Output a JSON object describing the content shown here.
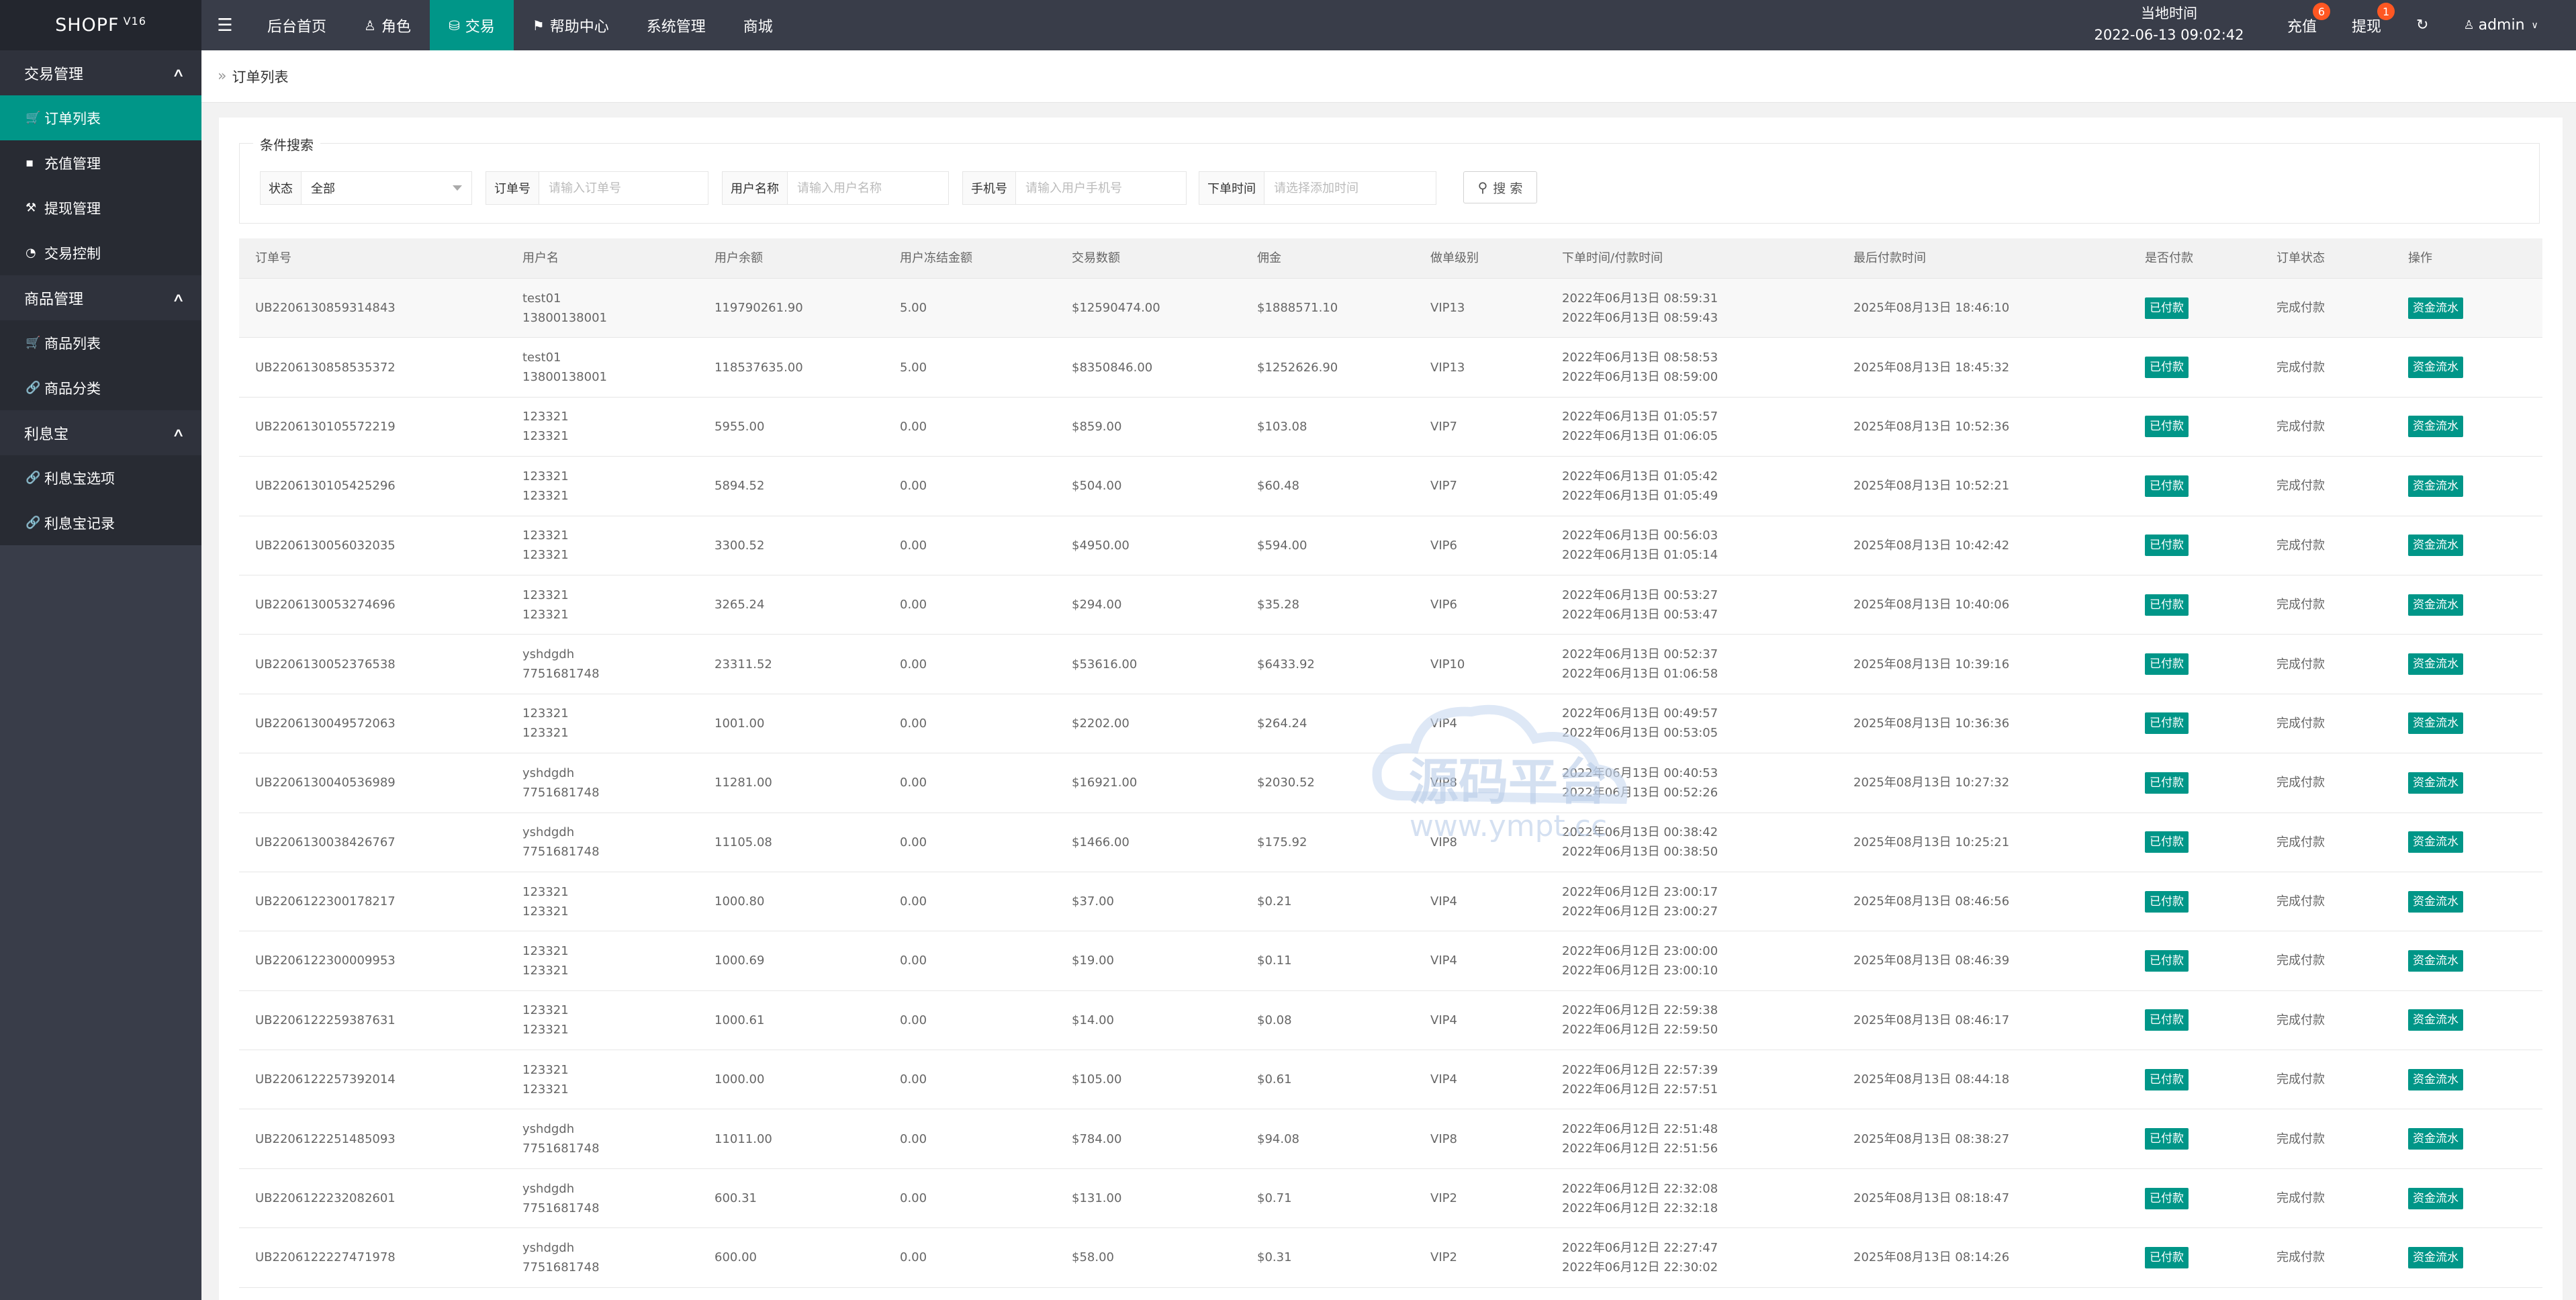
{
  "app": {
    "logo": "SHOPF",
    "version": "V16",
    "time_label": "当地时间",
    "time_value": "2022-06-13 09:02:42"
  },
  "topnav": {
    "items": [
      {
        "label": "后台首页"
      },
      {
        "label": "角色"
      },
      {
        "label": "交易"
      },
      {
        "label": "帮助中心"
      },
      {
        "label": "系统管理"
      },
      {
        "label": "商城"
      }
    ],
    "recharge_label": "充值",
    "recharge_badge": "6",
    "withdraw_label": "提现",
    "withdraw_badge": "1",
    "user_label": "admin"
  },
  "sidebar": {
    "group1": "交易管理",
    "g1_items": [
      "订单列表",
      "充值管理",
      "提现管理",
      "交易控制"
    ],
    "group2": "商品管理",
    "g2_items": [
      "商品列表",
      "商品分类"
    ],
    "group3": "利息宝",
    "g3_items": [
      "利息宝选项",
      "利息宝记录"
    ]
  },
  "breadcrumb": "订单列表",
  "search": {
    "legend": "条件搜索",
    "status_label": "状态",
    "status_value": "全部",
    "order_label": "订单号",
    "order_placeholder": "请输入订单号",
    "username_label": "用户名称",
    "username_placeholder": "请输入用户名称",
    "phone_label": "手机号",
    "phone_placeholder": "请输入用户手机号",
    "time_label": "下单时间",
    "time_placeholder": "请选择添加时间",
    "button": "搜 索"
  },
  "table": {
    "headers": [
      "订单号",
      "用户名",
      "用户余额",
      "用户冻结金额",
      "交易数额",
      "佣金",
      "做单级别",
      "下单时间/付款时间",
      "最后付款时间",
      "是否付款",
      "订单状态",
      "操作"
    ],
    "rows": [
      [
        "UB2206130859314843",
        "test01",
        "13800138001",
        "119790261.90",
        "5.00",
        "$12590474.00",
        "$1888571.10",
        "VIP13",
        "2022年06月13日 08:59:31",
        "2022年06月13日 08:59:43",
        "2025年08月13日 18:46:10",
        "已付款",
        "完成付款",
        "资金流水"
      ],
      [
        "UB2206130858535372",
        "test01",
        "13800138001",
        "118537635.00",
        "5.00",
        "$8350846.00",
        "$1252626.90",
        "VIP13",
        "2022年06月13日 08:58:53",
        "2022年06月13日 08:59:00",
        "2025年08月13日 18:45:32",
        "已付款",
        "完成付款",
        "资金流水"
      ],
      [
        "UB2206130105572219",
        "123321",
        "123321",
        "5955.00",
        "0.00",
        "$859.00",
        "$103.08",
        "VIP7",
        "2022年06月13日 01:05:57",
        "2022年06月13日 01:06:05",
        "2025年08月13日 10:52:36",
        "已付款",
        "完成付款",
        "资金流水"
      ],
      [
        "UB2206130105425296",
        "123321",
        "123321",
        "5894.52",
        "0.00",
        "$504.00",
        "$60.48",
        "VIP7",
        "2022年06月13日 01:05:42",
        "2022年06月13日 01:05:49",
        "2025年08月13日 10:52:21",
        "已付款",
        "完成付款",
        "资金流水"
      ],
      [
        "UB2206130056032035",
        "123321",
        "123321",
        "3300.52",
        "0.00",
        "$4950.00",
        "$594.00",
        "VIP6",
        "2022年06月13日 00:56:03",
        "2022年06月13日 01:05:14",
        "2025年08月13日 10:42:42",
        "已付款",
        "完成付款",
        "资金流水"
      ],
      [
        "UB2206130053274696",
        "123321",
        "123321",
        "3265.24",
        "0.00",
        "$294.00",
        "$35.28",
        "VIP6",
        "2022年06月13日 00:53:27",
        "2022年06月13日 00:53:47",
        "2025年08月13日 10:40:06",
        "已付款",
        "完成付款",
        "资金流水"
      ],
      [
        "UB2206130052376538",
        "yshdgdh",
        "7751681748",
        "23311.52",
        "0.00",
        "$53616.00",
        "$6433.92",
        "VIP10",
        "2022年06月13日 00:52:37",
        "2022年06月13日 01:06:58",
        "2025年08月13日 10:39:16",
        "已付款",
        "完成付款",
        "资金流水"
      ],
      [
        "UB2206130049572063",
        "123321",
        "123321",
        "1001.00",
        "0.00",
        "$2202.00",
        "$264.24",
        "VIP4",
        "2022年06月13日 00:49:57",
        "2022年06月13日 00:53:05",
        "2025年08月13日 10:36:36",
        "已付款",
        "完成付款",
        "资金流水"
      ],
      [
        "UB2206130040536989",
        "yshdgdh",
        "7751681748",
        "11281.00",
        "0.00",
        "$16921.00",
        "$2030.52",
        "VIP8",
        "2022年06月13日 00:40:53",
        "2022年06月13日 00:52:26",
        "2025年08月13日 10:27:32",
        "已付款",
        "完成付款",
        "资金流水"
      ],
      [
        "UB2206130038426767",
        "yshdgdh",
        "7751681748",
        "11105.08",
        "0.00",
        "$1466.00",
        "$175.92",
        "VIP8",
        "2022年06月13日 00:38:42",
        "2022年06月13日 00:38:50",
        "2025年08月13日 10:25:21",
        "已付款",
        "完成付款",
        "资金流水"
      ],
      [
        "UB2206122300178217",
        "123321",
        "123321",
        "1000.80",
        "0.00",
        "$37.00",
        "$0.21",
        "VIP4",
        "2022年06月12日 23:00:17",
        "2022年06月12日 23:00:27",
        "2025年08月13日 08:46:56",
        "已付款",
        "完成付款",
        "资金流水"
      ],
      [
        "UB2206122300009953",
        "123321",
        "123321",
        "1000.69",
        "0.00",
        "$19.00",
        "$0.11",
        "VIP4",
        "2022年06月12日 23:00:00",
        "2022年06月12日 23:00:10",
        "2025年08月13日 08:46:39",
        "已付款",
        "完成付款",
        "资金流水"
      ],
      [
        "UB2206122259387631",
        "123321",
        "123321",
        "1000.61",
        "0.00",
        "$14.00",
        "$0.08",
        "VIP4",
        "2022年06月12日 22:59:38",
        "2022年06月12日 22:59:50",
        "2025年08月13日 08:46:17",
        "已付款",
        "完成付款",
        "资金流水"
      ],
      [
        "UB2206122257392014",
        "123321",
        "123321",
        "1000.00",
        "0.00",
        "$105.00",
        "$0.61",
        "VIP4",
        "2022年06月12日 22:57:39",
        "2022年06月12日 22:57:51",
        "2025年08月13日 08:44:18",
        "已付款",
        "完成付款",
        "资金流水"
      ],
      [
        "UB2206122251485093",
        "yshdgdh",
        "7751681748",
        "11011.00",
        "0.00",
        "$784.00",
        "$94.08",
        "VIP8",
        "2022年06月12日 22:51:48",
        "2022年06月12日 22:51:56",
        "2025年08月13日 08:38:27",
        "已付款",
        "完成付款",
        "资金流水"
      ],
      [
        "UB2206122232082601",
        "yshdgdh",
        "7751681748",
        "600.31",
        "0.00",
        "$131.00",
        "$0.71",
        "VIP2",
        "2022年06月12日 22:32:08",
        "2022年06月12日 22:32:18",
        "2025年08月13日 08:18:47",
        "已付款",
        "完成付款",
        "资金流水"
      ],
      [
        "UB2206122227471978",
        "yshdgdh",
        "7751681748",
        "600.00",
        "0.00",
        "$58.00",
        "$0.31",
        "VIP2",
        "2022年06月12日 22:27:47",
        "2022年06月12日 22:30:02",
        "2025年08月13日 08:14:26",
        "已付款",
        "完成付款",
        "资金流水"
      ]
    ]
  },
  "watermark": {
    "title": "源码平台",
    "url": "www.ympt.cc"
  }
}
